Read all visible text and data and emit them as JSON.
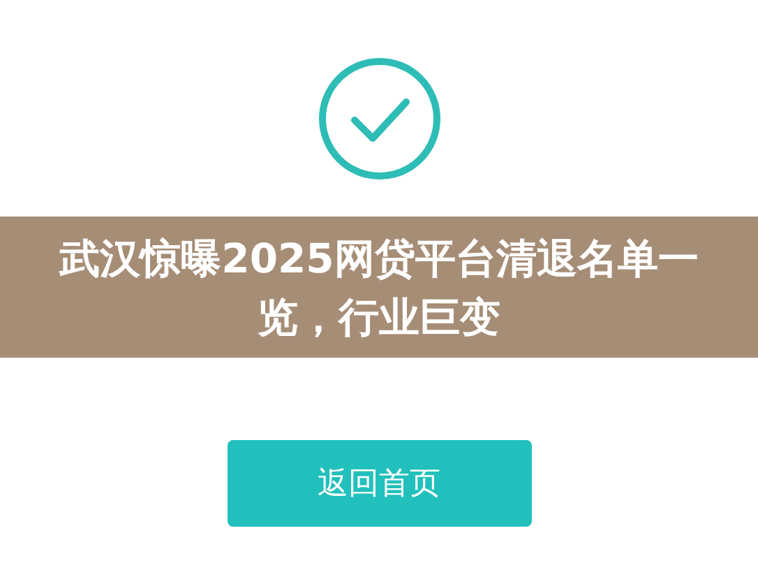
{
  "banner": {
    "title": "武汉惊曝2025网贷平台清退名单一览，行业巨变"
  },
  "button": {
    "label": "返回首页"
  }
}
